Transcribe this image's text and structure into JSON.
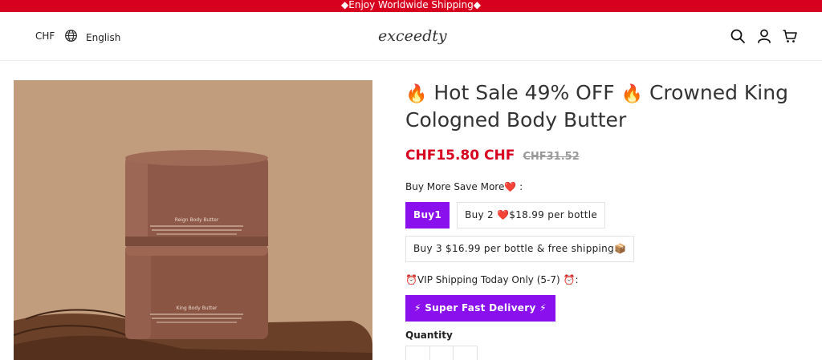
{
  "announcement": "◆Enjoy Worldwide Shipping◆",
  "header": {
    "currency": "CHF",
    "language": "English",
    "logo": "exceedty",
    "icons": [
      "search-icon",
      "account-icon",
      "cart-icon"
    ]
  },
  "product": {
    "title_line1": "Hot Sale 49% OFF",
    "title_line2": "Crowned King Cologned Body Butter",
    "fire_emoji": "🔥",
    "price": "CHF15.80 CHF",
    "compare_price": "CHF31.52",
    "image_labels": {
      "top_jar": "Reign Body Butter",
      "bottom_jar": "King Body Butter"
    }
  },
  "bundle": {
    "label": "Buy More Save More❤️ :",
    "options": [
      {
        "label": "Buy1",
        "selected": true
      },
      {
        "label": "Buy 2 ❤️$18.99 per bottle",
        "selected": false
      },
      {
        "label": "Buy 3 $16.99 per bottle & free shipping📦",
        "selected": false
      }
    ]
  },
  "shipping": {
    "label": "⏰VIP Shipping Today Only  (5-7)  ⏰:",
    "delivery_button": "⚡ Super Fast Delivery ⚡"
  },
  "quantity": {
    "label": "Quantity"
  },
  "colors": {
    "announcement": "#d8001f",
    "price": "#d8001f",
    "accent": "#8a11ee",
    "image_bg": "#c19c7d"
  }
}
